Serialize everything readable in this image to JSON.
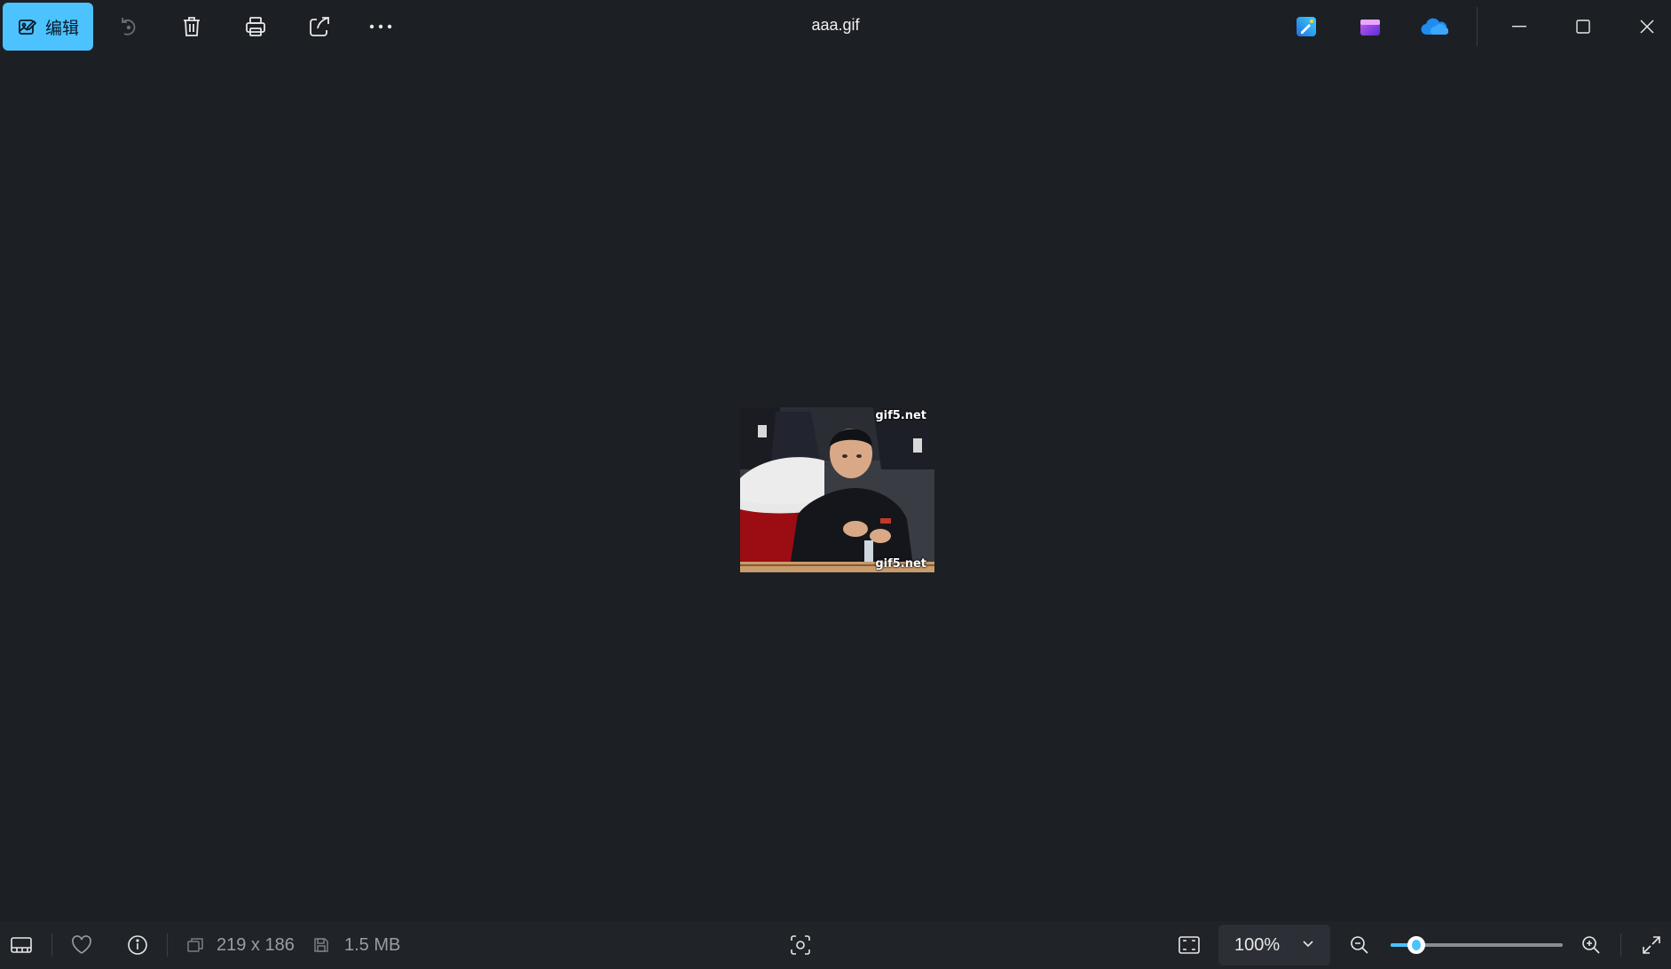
{
  "toolbar": {
    "edit_label": "编辑",
    "icons": [
      "edit-image-icon",
      "rotate-icon",
      "delete-icon",
      "print-icon",
      "share-icon",
      "more-icon"
    ]
  },
  "window": {
    "title": "aaa.gif",
    "right_icons": [
      "designer-app-icon",
      "clipchamp-icon",
      "onedrive-icon"
    ],
    "controls": [
      "minimize-icon",
      "maximize-icon",
      "close-icon"
    ]
  },
  "image": {
    "watermark_top": "gif5.net",
    "watermark_bottom": "gif5.net"
  },
  "status": {
    "dimensions": "219 x 186",
    "file_size": "1.5 MB",
    "zoom_value": "100%",
    "zoom_level": 0.15
  },
  "colors": {
    "accent": "#4cc2ff",
    "background": "#1c1f24",
    "statusbar": "#202328"
  }
}
